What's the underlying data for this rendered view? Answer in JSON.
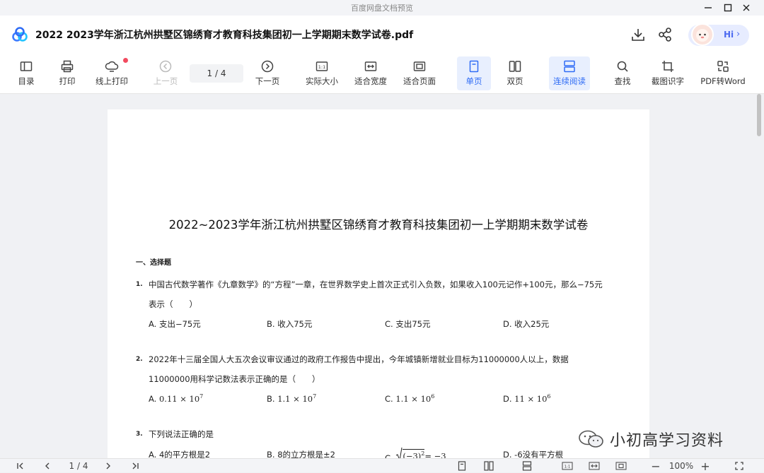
{
  "window": {
    "title": "百度网盘文档预览",
    "minimize_icon": "minimize-icon",
    "maximize_icon": "maximize-icon",
    "close_icon": "close-icon"
  },
  "header": {
    "logo_icon": "baidu-netdisk-logo",
    "doc_title": "2022 2023学年浙江杭州拱墅区锦绣育才教育科技集团初一上学期期末数学试卷.pdf",
    "download_icon": "download-icon",
    "share_icon": "share-icon",
    "assistant_label": "Hi"
  },
  "toolbar": {
    "items": [
      {
        "label": "目录",
        "icon": "toc-icon"
      },
      {
        "label": "打印",
        "icon": "print-icon"
      },
      {
        "label": "线上打印",
        "icon": "online-print-icon"
      },
      {
        "label": "上一页",
        "icon": "prev-page-icon"
      },
      {
        "label": "下一页",
        "icon": "next-page-icon"
      },
      {
        "label": "实际大小",
        "icon": "actual-size-icon"
      },
      {
        "label": "适合宽度",
        "icon": "fit-width-icon"
      },
      {
        "label": "适合页面",
        "icon": "fit-page-icon"
      },
      {
        "label": "单页",
        "icon": "single-page-icon"
      },
      {
        "label": "双页",
        "icon": "double-page-icon"
      },
      {
        "label": "连续阅读",
        "icon": "continuous-read-icon"
      },
      {
        "label": "查找",
        "icon": "search-icon"
      },
      {
        "label": "截图识字",
        "icon": "screenshot-ocr-icon"
      },
      {
        "label": "PDF转Word",
        "icon": "pdf-to-word-icon"
      }
    ],
    "page_indicator": "1 / 4"
  },
  "document": {
    "title": "2022~2023学年浙江杭州拱墅区锦绣育才教育科技集团初一上学期期末数学试卷",
    "section": "一、选择题",
    "questions": [
      {
        "num": "1.",
        "line1": "中国古代数学著作《九章数学》的“方程”一章，在世界数学史上首次正式引入负数，如果收入100元记作+100元，那么−75元",
        "line2": "表示（　　）",
        "options": [
          "A. 支出−75元",
          "B. 收入75元",
          "C. 支出75元",
          "D. 收入25元"
        ]
      },
      {
        "num": "2.",
        "line1": "2022年十三届全国人大五次会议审议通过的政府工作报告中提出，今年城镇新增就业目标为11000000人以上，数据",
        "line2": "11000000用科学记数法表示正确的是（　　）",
        "options": [
          {
            "prefix": "A. ",
            "base": "0.11 × 10",
            "exp": "7"
          },
          {
            "prefix": "B. ",
            "base": "1.1 × 10",
            "exp": "7"
          },
          {
            "prefix": "C. ",
            "base": "1.1 × 10",
            "exp": "6"
          },
          {
            "prefix": "D. ",
            "base": "11 × 10",
            "exp": "6"
          }
        ]
      },
      {
        "num": "3.",
        "line1": "下列说法正确的是",
        "options": [
          "A. 4的平方根是2",
          "B. 8的立方根是±2",
          "C. ",
          "D. -6没有平方根"
        ],
        "option_c_math": {
          "radicand": "(−3)",
          "exp": "2",
          "rest": " = −3"
        }
      }
    ]
  },
  "watermark": {
    "text": "小初高学习资料",
    "icon": "wechat-icon"
  },
  "statusbar": {
    "page_indicator": "1 / 4",
    "zoom": "100%",
    "first_icon": "first-page-icon",
    "prev_icon": "prev-page-icon",
    "next_icon": "next-page-icon",
    "last_icon": "last-page-icon"
  }
}
